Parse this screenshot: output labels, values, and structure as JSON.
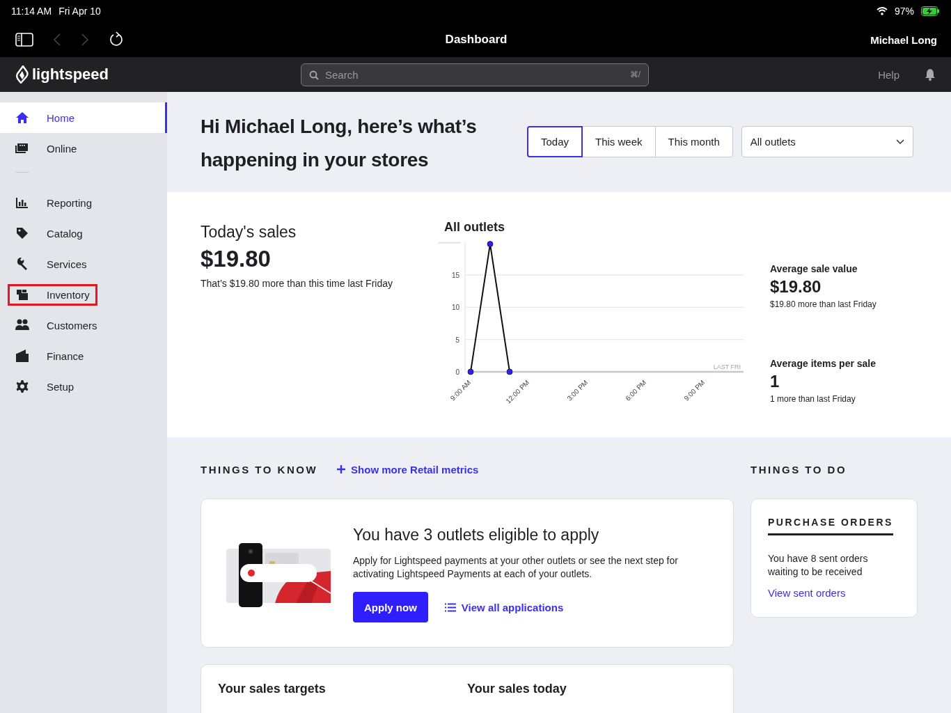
{
  "status_bar": {
    "time": "11:14 AM",
    "date": "Fri Apr 10",
    "battery": "97%"
  },
  "browser": {
    "title": "Dashboard",
    "user": "Michael Long"
  },
  "header": {
    "logo": "lightspeed",
    "search": {
      "placeholder": "Search",
      "shortcut": "⌘/"
    },
    "help": "Help"
  },
  "sidebar": {
    "groups": [
      {
        "items": [
          {
            "label": "Home",
            "selected": true,
            "highlighted": false
          },
          {
            "label": "Online",
            "selected": false,
            "highlighted": false
          }
        ]
      },
      {
        "items": [
          {
            "label": "Reporting",
            "selected": false,
            "highlighted": false
          },
          {
            "label": "Catalog",
            "selected": false,
            "highlighted": false
          },
          {
            "label": "Services",
            "selected": false,
            "highlighted": false
          },
          {
            "label": "Inventory",
            "selected": false,
            "highlighted": true
          },
          {
            "label": "Customers",
            "selected": false,
            "highlighted": false
          },
          {
            "label": "Finance",
            "selected": false,
            "highlighted": false
          },
          {
            "label": "Setup",
            "selected": false,
            "highlighted": false
          }
        ]
      }
    ]
  },
  "greeting": "Hi Michael Long, here’s what’s happening in your stores",
  "periods": [
    {
      "label": "Today",
      "selected": true
    },
    {
      "label": "This week",
      "selected": false
    },
    {
      "label": "This month",
      "selected": false
    }
  ],
  "outlet_select": {
    "value": "All outlets"
  },
  "sales": {
    "title": "Today's sales",
    "amount": "$19.80",
    "note": "That’s $19.80 more than this time last Friday"
  },
  "chart": {
    "chart_data": {
      "type": "line",
      "title": "All outlets",
      "x": [
        9,
        10,
        11,
        12,
        13,
        14,
        15,
        16,
        17,
        18,
        19,
        20,
        21,
        22,
        23
      ],
      "xlim": [
        9,
        23
      ],
      "ylim": [
        0,
        20
      ],
      "yticks": [
        0,
        5,
        10,
        15
      ],
      "grid": true,
      "xticks": [
        {
          "value": 9,
          "label": "9:00 AM"
        },
        {
          "value": 12,
          "label": "12:00 PM"
        },
        {
          "value": 15,
          "label": "3:00 PM"
        },
        {
          "value": 18,
          "label": "6:00 PM"
        },
        {
          "value": 21,
          "label": "9:00 PM"
        }
      ],
      "series": [
        {
          "color": "#c6c7cf",
          "values": [
            0,
            0,
            0,
            0,
            0,
            0,
            0,
            0,
            0,
            0,
            0,
            0,
            0,
            0,
            0
          ]
        },
        {
          "color": "#111111",
          "marker": "circle",
          "values": [
            0,
            19.8,
            0,
            null,
            null,
            null,
            null,
            null,
            null,
            null,
            null,
            null,
            null,
            null,
            null
          ]
        }
      ],
      "annotations": [
        "LAST FRI"
      ]
    }
  },
  "stats": [
    {
      "label": "Average sale value",
      "value": "$19.80",
      "note": "$19.80 more than last Friday"
    },
    {
      "label": "Average items per sale",
      "value": "1",
      "note": "1 more than last Friday"
    }
  ],
  "things_to_know": {
    "title": "THINGS TO KNOW",
    "link": "Show more Retail metrics"
  },
  "promo": {
    "title": "You have 3 outlets eligible to apply",
    "body": "Apply for Lightspeed payments at your other outlets or see the next step for activating Lightspeed Payments at each of your outlets.",
    "button": "Apply now",
    "link": "View all applications"
  },
  "things_to_do": {
    "title": "THINGS TO DO",
    "card": {
      "title": "PURCHASE ORDERS",
      "body": "You have 8 sent orders waiting to be received",
      "link": "View sent orders"
    }
  },
  "targets": {
    "left": "Your sales targets",
    "right": "Your sales today"
  }
}
